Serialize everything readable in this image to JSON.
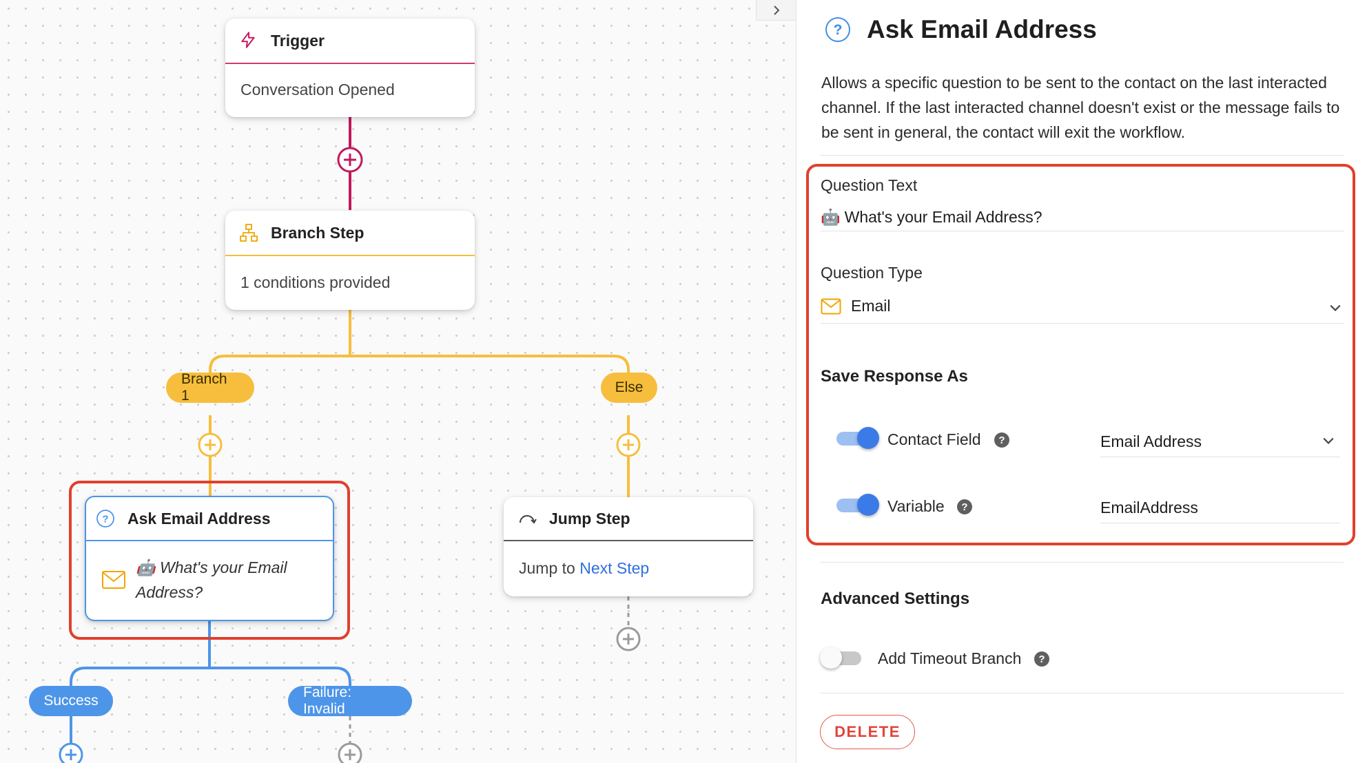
{
  "canvas": {
    "trigger": {
      "title": "Trigger",
      "body": "Conversation Opened"
    },
    "branch_step": {
      "title": "Branch Step",
      "body": "1 conditions provided"
    },
    "branches": {
      "branch1": "Branch 1",
      "else": "Else"
    },
    "ask_email_node": {
      "title": "Ask Email Address",
      "body_emoji": "🤖",
      "body_line1": "What's your Email",
      "body_line2": "Address?"
    },
    "jump_step": {
      "title": "Jump Step",
      "body_prefix": "Jump to",
      "body_link": "Next Step"
    },
    "outcomes": {
      "success": "Success",
      "failure": "Failure: Invalid"
    }
  },
  "panel": {
    "title": "Ask Email Address",
    "description": "Allows a specific question to be sent to the contact on the last interacted channel. If the last interacted channel doesn't exist or the message fails to be sent in general, the contact will exit the workflow.",
    "question_text": {
      "label": "Question Text",
      "emoji": "🤖",
      "value": "What's your Email Address?"
    },
    "question_type": {
      "label": "Question Type",
      "value": "Email"
    },
    "save_response": {
      "title": "Save Response As",
      "contact_field": {
        "label": "Contact Field",
        "enabled": true,
        "value": "Email Address"
      },
      "variable": {
        "label": "Variable",
        "enabled": true,
        "value": "EmailAddress"
      }
    },
    "advanced": {
      "title": "Advanced Settings",
      "timeout_branch": {
        "label": "Add Timeout Branch",
        "enabled": false
      }
    },
    "delete_label": "DELETE"
  },
  "colors": {
    "trigger_accent": "#c2185b",
    "branch_accent": "#f6be3c",
    "question_accent": "#4d95e8",
    "highlight": "#e0402c",
    "link": "#2f6fe0"
  }
}
